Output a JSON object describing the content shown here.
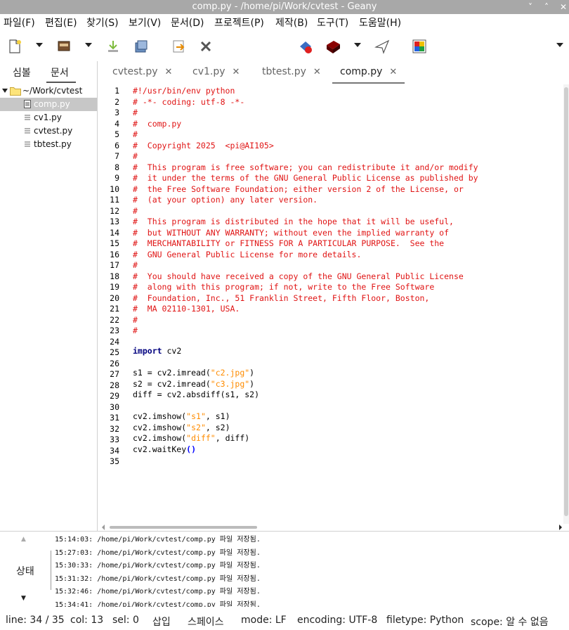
{
  "window": {
    "title": "comp.py - /home/pi/Work/cvtest - Geany",
    "minimize": "˅",
    "maximize": "˄",
    "close": "✕"
  },
  "menu": [
    "파일(F)",
    "편집(E)",
    "찾기(S)",
    "보기(V)",
    "문서(D)",
    "프로젝트(P)",
    "제작(B)",
    "도구(T)",
    "도움말(H)"
  ],
  "sidebar": {
    "tabs": [
      "심볼",
      "문서"
    ],
    "folder": "~/Work/cvtest",
    "files": [
      "comp.py",
      "cv1.py",
      "cvtest.py",
      "tbtest.py"
    ],
    "selected": "comp.py"
  },
  "editor_tabs": [
    {
      "label": "cvtest.py",
      "close": "✕"
    },
    {
      "label": "cv1.py",
      "close": "✕"
    },
    {
      "label": "tbtest.py",
      "close": "✕"
    },
    {
      "label": "comp.py",
      "close": "✕"
    }
  ],
  "code": {
    "line_numbers": [
      "1",
      "2",
      "3",
      "4",
      "5",
      "6",
      "7",
      "8",
      "9",
      "10",
      "11",
      "12",
      "13",
      "14",
      "15",
      "16",
      "17",
      "18",
      "19",
      "20",
      "21",
      "22",
      "23",
      "24",
      "25",
      "26",
      "27",
      "28",
      "29",
      "30",
      "31",
      "32",
      "33",
      "34",
      "35"
    ],
    "comments": [
      "#!/usr/bin/env python",
      "# -*- coding: utf-8 -*-",
      "#",
      "#  comp.py",
      "#",
      "#  Copyright 2025  <pi@AI105>",
      "#",
      "#  This program is free software; you can redistribute it and/or modify",
      "#  it under the terms of the GNU General Public License as published by",
      "#  the Free Software Foundation; either version 2 of the License, or",
      "#  (at your option) any later version.",
      "#",
      "#  This program is distributed in the hope that it will be useful,",
      "#  but WITHOUT ANY WARRANTY; without even the implied warranty of",
      "#  MERCHANTABILITY or FITNESS FOR A PARTICULAR PURPOSE.  See the",
      "#  GNU General Public License for more details.",
      "#",
      "#  You should have received a copy of the GNU General Public License",
      "#  along with this program; if not, write to the Free Software",
      "#  Foundation, Inc., 51 Franklin Street, Fifth Floor, Boston,",
      "#  MA 02110-1301, USA.",
      "#",
      "#"
    ],
    "import_kw": "import",
    "import_mod": " cv2",
    "l27a": "s1 = cv2.imread(",
    "l27s": "\"c2.jpg\"",
    "l27b": ")",
    "l28a": "s2 = cv2.imread(",
    "l28s": "\"c3.jpg\"",
    "l28b": ")",
    "l29": "diff = cv2.absdiff(s1, s2)",
    "l31a": "cv2.imshow(",
    "l31s": "\"s1\"",
    "l31b": ", s1)",
    "l32a": "cv2.imshow(",
    "l32s": "\"s2\"",
    "l32b": ", s2)",
    "l33a": "cv2.imshow(",
    "l33s": "\"diff\"",
    "l33b": ", diff)",
    "l34a": "cv2.waitKey",
    "l34p": "()"
  },
  "messages": {
    "side_label": "상태",
    "up_arrow": "▲",
    "down_arrow": "▼",
    "lines": [
      "15:14:03: /home/pi/Work/cvtest/comp.py 파일 저장됨.",
      "15:27:03: /home/pi/Work/cvtest/comp.py 파일 저장됨.",
      "15:30:33: /home/pi/Work/cvtest/comp.py 파일 저장됨.",
      "15:31:32: /home/pi/Work/cvtest/comp.py 파일 저장됨.",
      "15:32:46: /home/pi/Work/cvtest/comp.py 파일 저장됨.",
      "15:34:41: /home/pi/Work/cvtest/comp.py 파일 저장됨."
    ]
  },
  "status": {
    "line": "line: 34 / 35",
    "col": "col: 13",
    "sel": "sel: 0",
    "insert": "삽입",
    "indent": "스페이스",
    "mode": "mode: LF",
    "encoding": "encoding: UTF-8",
    "filetype": "filetype: Python",
    "scope": "scope: 알 수 없음"
  },
  "icons": {
    "new": "new-file-icon",
    "open": "open-file-icon",
    "save": "save-icon",
    "save_all": "save-all-icon",
    "revert": "revert-icon",
    "close": "close-file-icon",
    "compile": "compile-icon",
    "build": "build-icon",
    "run": "run-icon",
    "color": "color-chooser-icon"
  }
}
